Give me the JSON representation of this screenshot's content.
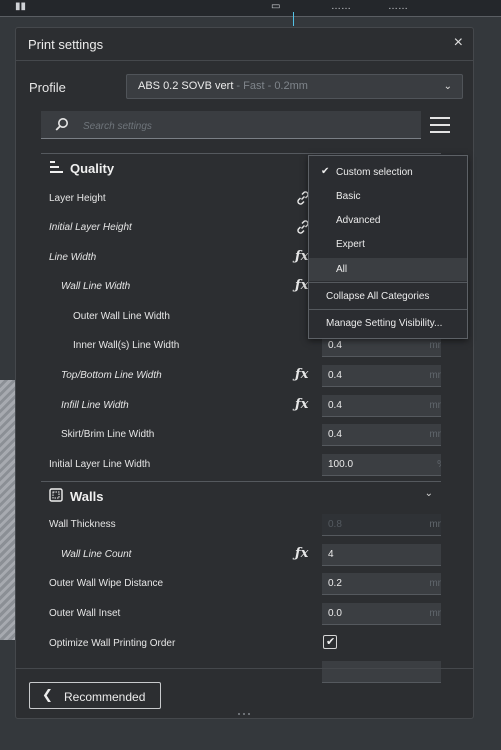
{
  "panel": {
    "title": "Print settings",
    "close_label": "×",
    "profile_label": "Profile",
    "profile_value": "ABS 0.2 SOVB vert",
    "profile_sub": " - Fast - 0.2mm",
    "search_placeholder": "Search settings",
    "recommended_label": "Recommended"
  },
  "categories": {
    "quality": "Quality",
    "walls": "Walls"
  },
  "quality_rows": [
    {
      "label": "Layer Height"
    },
    {
      "label": "Initial Layer Height"
    },
    {
      "label": "Line Width"
    },
    {
      "label": "Wall Line Width"
    },
    {
      "label": "Outer Wall Line Width"
    },
    {
      "label": "Inner Wall(s) Line Width",
      "value": "0.4",
      "unit": "mm"
    },
    {
      "label": "Top/Bottom Line Width",
      "value": "0.4",
      "unit": "mm"
    },
    {
      "label": "Infill Line Width",
      "value": "0.4",
      "unit": "mm"
    },
    {
      "label": "Skirt/Brim Line Width",
      "value": "0.4",
      "unit": "mm"
    },
    {
      "label": "Initial Layer Line Width",
      "value": "100.0",
      "unit": "%"
    }
  ],
  "walls_rows": [
    {
      "label": "Wall Thickness",
      "value": "0.8",
      "unit": "mm"
    },
    {
      "label": "Wall Line Count",
      "value": "4"
    },
    {
      "label": "Outer Wall Wipe Distance",
      "value": "0.2",
      "unit": "mm"
    },
    {
      "label": "Outer Wall Inset",
      "value": "0.0",
      "unit": "mm"
    },
    {
      "label": "Optimize Wall Printing Order",
      "checked": true
    }
  ],
  "visibility_menu": {
    "items": [
      "Custom selection",
      "Basic",
      "Advanced",
      "Expert",
      "All"
    ],
    "selected": "Custom selection",
    "highlighted": "All",
    "collapse_label": "Collapse All Categories",
    "manage_label": "Manage Setting Visibility..."
  },
  "icons": {
    "fx": "ƒx",
    "link": "link-icon",
    "check": "✔",
    "tick": "✔",
    "chevron": "⌄",
    "back": "❮"
  },
  "colors": {
    "panel_bg": "#2c2e31",
    "accent_blue": "#52c2e6"
  }
}
